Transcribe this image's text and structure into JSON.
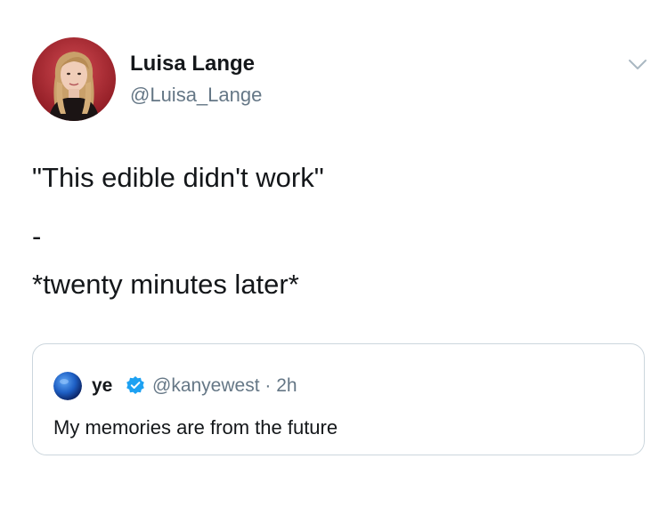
{
  "tweet": {
    "display_name": "Luisa Lange",
    "handle": "@Luisa_Lange",
    "avatar_icon": "profile-photo",
    "menu_icon": "chevron-down-icon",
    "lines": [
      "\"This edible didn't work\"",
      "-",
      "*twenty minutes later*"
    ]
  },
  "quoted_tweet": {
    "display_name": "ye",
    "verified_icon": "verified-badge-icon",
    "handle": "@kanyewest",
    "separator": "·",
    "time": "2h",
    "text": "My memories are from the future"
  },
  "colors": {
    "primary_text": "#14171a",
    "secondary_text": "#657786",
    "border": "#ccd6dd",
    "verified": "#1da1f2"
  }
}
